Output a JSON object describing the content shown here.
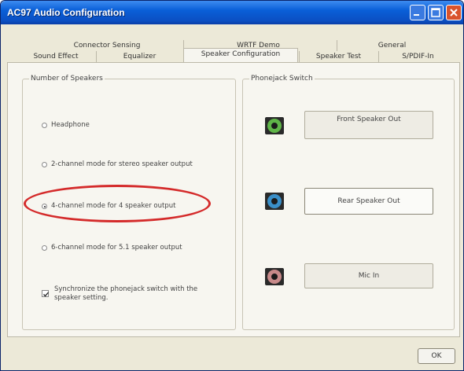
{
  "window": {
    "title": "AC97 Audio Configuration"
  },
  "tabs": {
    "row1": [
      "Connector Sensing",
      "WRTF Demo",
      "General"
    ],
    "row2": [
      "Sound Effect",
      "Equalizer",
      "Speaker Configuration",
      "Speaker Test",
      "S/PDIF-In"
    ],
    "active": "Speaker Configuration"
  },
  "speakers": {
    "title": "Number of Speakers",
    "options": [
      "Headphone",
      "2-channel mode for stereo speaker output",
      "4-channel mode for 4 speaker output",
      "6-channel mode for 5.1 speaker output"
    ],
    "selected": "4-channel mode for 4 speaker output",
    "sync_line1": "Synchronize the phonejack switch with the",
    "sync_line2": "speaker setting.",
    "sync_checked": true
  },
  "phonejack": {
    "title": "Phonejack Switch",
    "jacks": [
      {
        "label": "Front Speaker Out",
        "color": "#5fb548"
      },
      {
        "label": "Rear Speaker Out",
        "color": "#3a8fc8"
      },
      {
        "label": "Mic In",
        "color": "#c88a8a"
      }
    ]
  },
  "footer": {
    "ok_label": "OK"
  },
  "colors": {
    "titlebar": "#0a5fd8",
    "highlight_circle": "#d42a2a"
  }
}
